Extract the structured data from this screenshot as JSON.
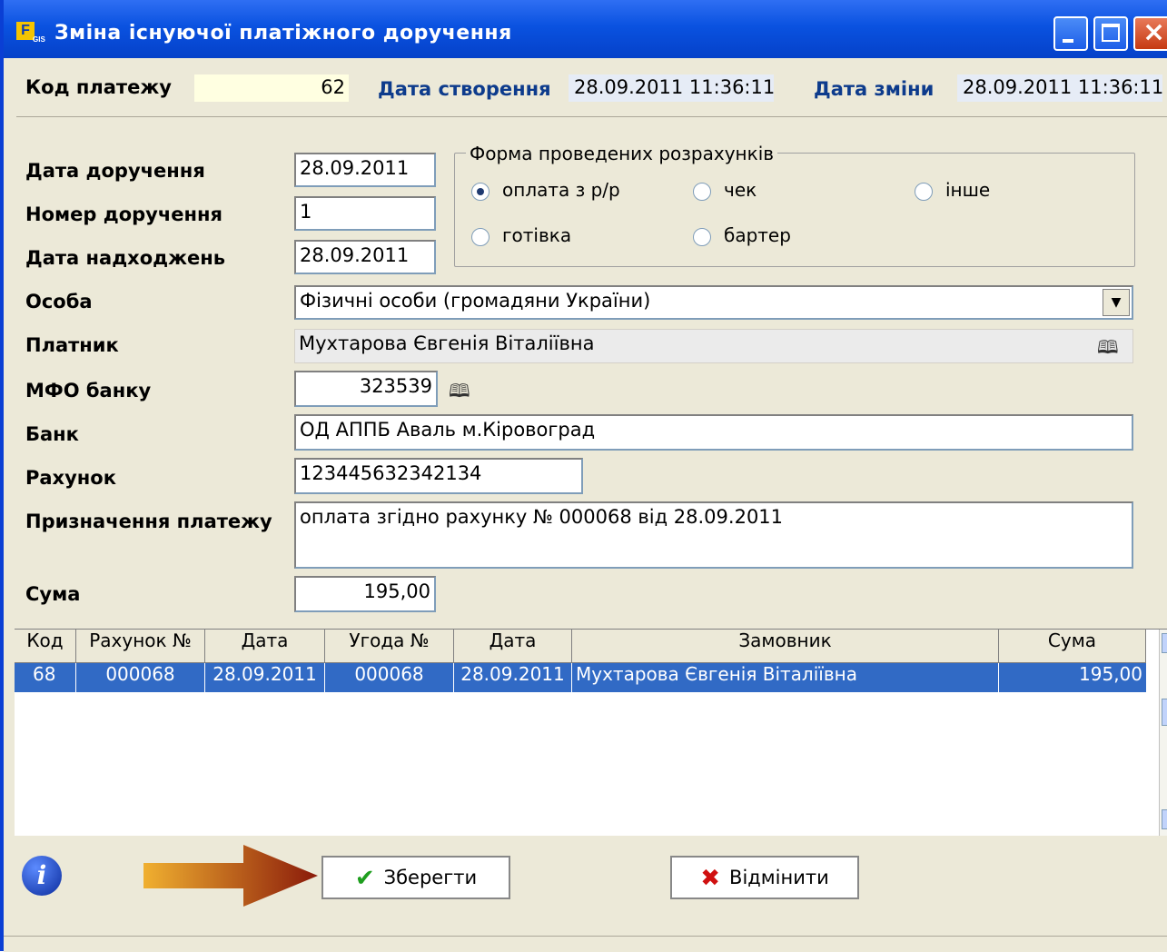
{
  "window": {
    "title": "Зміна існуючої платіжного доручення",
    "app_icon_letter": "F",
    "app_icon_sub": "GIS"
  },
  "header": {
    "code_label": "Код платежу",
    "code_value": "62",
    "created_label": "Дата створення",
    "created_value": "28.09.2011 11:36:11",
    "changed_label": "Дата зміни",
    "changed_value": "28.09.2011 11:36:11"
  },
  "form": {
    "order_date_label": "Дата доручення",
    "order_date_value": "28.09.2011",
    "order_number_label": "Номер доручення",
    "order_number_value": "1",
    "receipt_date_label": "Дата надходжень",
    "receipt_date_value": "28.09.2011",
    "person_label": "Особа",
    "person_value": "Фізичні особи (громадяни України)",
    "payer_label": "Платник",
    "payer_value": "Мухтарова Євгенія Віталіївна",
    "mfo_label": "МФО банку",
    "mfo_value": "323539",
    "bank_label": "Банк",
    "bank_value": "ОД АППБ Аваль м.Кіровоград",
    "account_label": "Рахунок",
    "account_value": "123445632342134",
    "purpose_label": "Призначення платежу",
    "purpose_value": "оплата згідно рахунку № 000068 від 28.09.2011",
    "sum_label": "Сума",
    "sum_value": "195,00"
  },
  "payment_form": {
    "title": "Форма проведених розрахунків",
    "options": [
      {
        "label": "оплата з р/р",
        "selected": true
      },
      {
        "label": "чек",
        "selected": false
      },
      {
        "label": "інше",
        "selected": false
      },
      {
        "label": "готівка",
        "selected": false
      },
      {
        "label": "бартер",
        "selected": false
      }
    ]
  },
  "table": {
    "columns": [
      "Код",
      "Рахунок №",
      "Дата",
      "Угода №",
      "Дата",
      "Замовник",
      "Сума"
    ],
    "rows": [
      [
        "68",
        "000068",
        "28.09.2011",
        "000068",
        "28.09.2011",
        "Мухтарова Євгенія Віталіївна",
        "195,00"
      ]
    ]
  },
  "buttons": {
    "save_label": "Зберегти",
    "cancel_label": "Відмінити"
  },
  "colors": {
    "titlebar": "#0a52e0",
    "selection": "#316ac5",
    "save_check": "#1e9e1e",
    "cancel_x": "#d01010",
    "arrow": "#b84a14"
  }
}
